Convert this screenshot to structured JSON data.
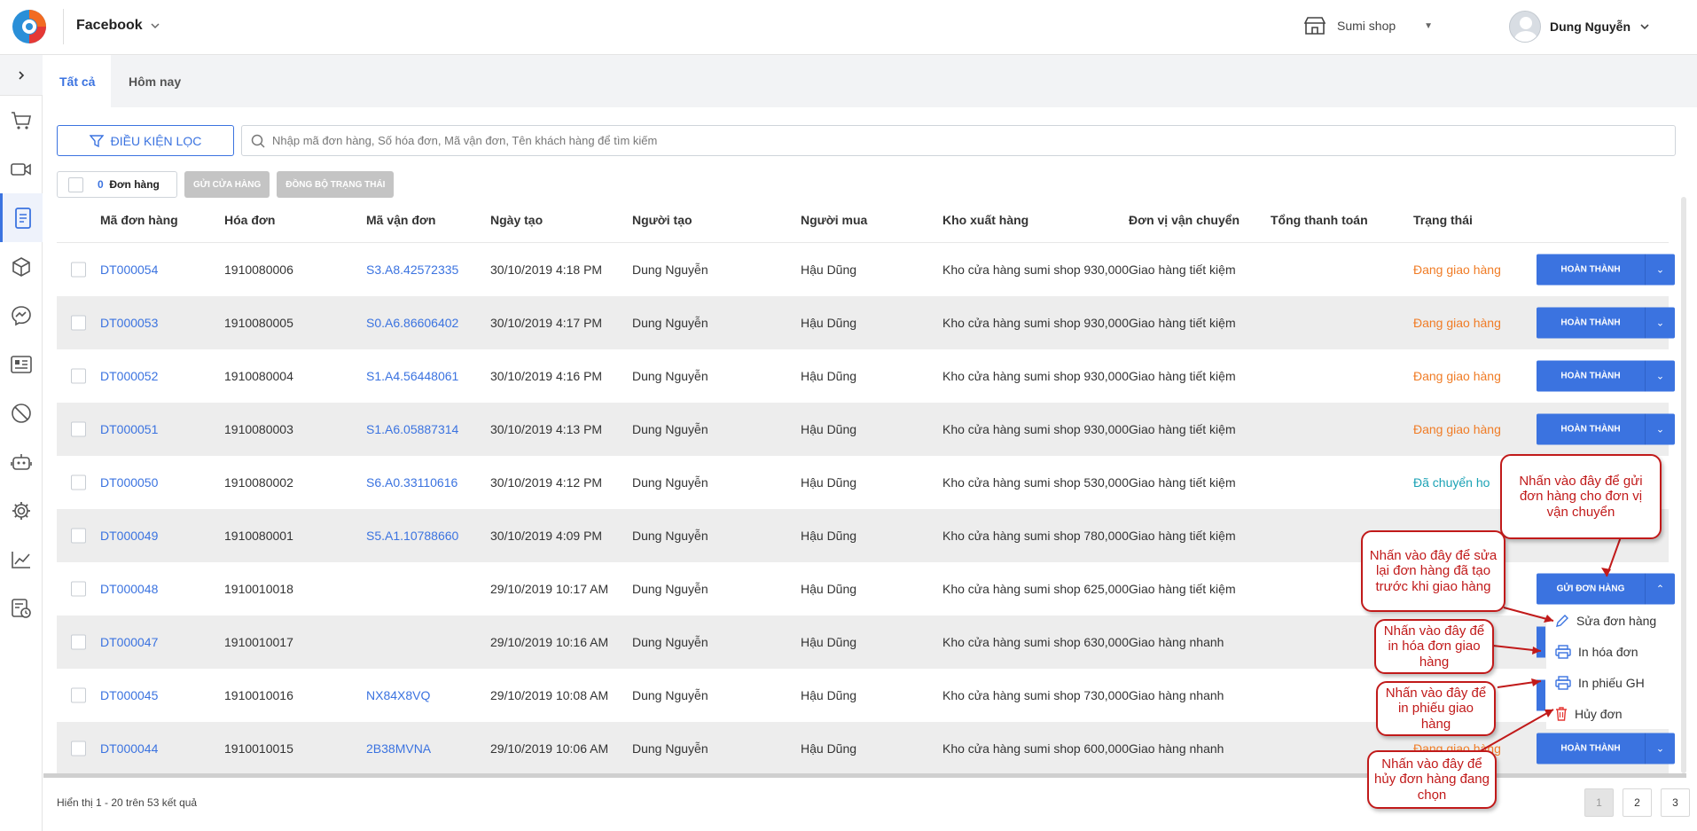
{
  "header": {
    "app_name": "Facebook",
    "shop_name": "Sumi shop",
    "user_name": "Dung Nguyễn"
  },
  "tabs": [
    {
      "label": "Tất cả"
    },
    {
      "label": "Hôm nay"
    }
  ],
  "filter": {
    "button_label": "ĐIỀU KIỆN LỌC",
    "search_placeholder": "Nhập mã đơn hàng, Số hóa đơn, Mã vận đơn, Tên khách hàng để tìm kiếm"
  },
  "bulk": {
    "count": "0",
    "count_label": "Đơn hàng",
    "send_store_label": "GỬI CỬA HÀNG",
    "sync_status_label": "ĐỒNG BỘ TRẠNG THÁI"
  },
  "columns": [
    "Mã đơn hàng",
    "Hóa đơn",
    "Mã vận đơn",
    "Ngày tạo",
    "Người tạo",
    "Người mua",
    "Kho xuất hàng",
    "Đơn vị vận chuyển",
    "Tổng thanh toán",
    "Trạng thái"
  ],
  "rows": [
    {
      "code": "DT000054",
      "invoice": "1910080006",
      "tracking": "S3.A8.42572335",
      "date": "30/10/2019 4:18 PM",
      "creator": "Dung Nguyễn",
      "buyer": "Hậu Dũng",
      "warehouse": "Kho cửa hàng sumi shop",
      "carrier": "Giao hàng tiết kiệm",
      "total": "930,000",
      "status": "Đang giao hàng",
      "action": "HOÀN THÀNH"
    },
    {
      "code": "DT000053",
      "invoice": "1910080005",
      "tracking": "S0.A6.86606402",
      "date": "30/10/2019 4:17 PM",
      "creator": "Dung Nguyễn",
      "buyer": "Hậu Dũng",
      "warehouse": "Kho cửa hàng sumi shop",
      "carrier": "Giao hàng tiết kiệm",
      "total": "930,000",
      "status": "Đang giao hàng",
      "action": "HOÀN THÀNH"
    },
    {
      "code": "DT000052",
      "invoice": "1910080004",
      "tracking": "S1.A4.56448061",
      "date": "30/10/2019 4:16 PM",
      "creator": "Dung Nguyễn",
      "buyer": "Hậu Dũng",
      "warehouse": "Kho cửa hàng sumi shop",
      "carrier": "Giao hàng tiết kiệm",
      "total": "930,000",
      "status": "Đang giao hàng",
      "action": "HOÀN THÀNH"
    },
    {
      "code": "DT000051",
      "invoice": "1910080003",
      "tracking": "S1.A6.05887314",
      "date": "30/10/2019 4:13 PM",
      "creator": "Dung Nguyễn",
      "buyer": "Hậu Dũng",
      "warehouse": "Kho cửa hàng sumi shop",
      "carrier": "Giao hàng tiết kiệm",
      "total": "930,000",
      "status": "Đang giao hàng",
      "action": "HOÀN THÀNH"
    },
    {
      "code": "DT000050",
      "invoice": "1910080002",
      "tracking": "S6.A0.33110616",
      "date": "30/10/2019 4:12 PM",
      "creator": "Dung Nguyễn",
      "buyer": "Hậu Dũng",
      "warehouse": "Kho cửa hàng sumi shop",
      "carrier": "Giao hàng tiết kiệm",
      "total": "530,000",
      "status": "Đã chuyển ho",
      "action": ""
    },
    {
      "code": "DT000049",
      "invoice": "1910080001",
      "tracking": "S5.A1.10788660",
      "date": "30/10/2019 4:09 PM",
      "creator": "Dung Nguyễn",
      "buyer": "Hậu Dũng",
      "warehouse": "Kho cửa hàng sumi shop",
      "carrier": "Giao hàng tiết kiệm",
      "total": "780,000",
      "status": "",
      "action": ""
    },
    {
      "code": "DT000048",
      "invoice": "1910010018",
      "tracking": "",
      "date": "29/10/2019 10:17 AM",
      "creator": "Dung Nguyễn",
      "buyer": "Hậu Dũng",
      "warehouse": "Kho cửa hàng sumi shop",
      "carrier": "Giao hàng tiết kiệm",
      "total": "625,000",
      "status": "",
      "action": "GỬI ĐƠN HÀNG"
    },
    {
      "code": "DT000047",
      "invoice": "1910010017",
      "tracking": "",
      "date": "29/10/2019 10:16 AM",
      "creator": "Dung Nguyễn",
      "buyer": "Hậu Dũng",
      "warehouse": "Kho cửa hàng sumi shop",
      "carrier": "Giao hàng nhanh",
      "total": "630,000",
      "status": "",
      "action": ""
    },
    {
      "code": "DT000045",
      "invoice": "1910010016",
      "tracking": "NX84X8VQ",
      "date": "29/10/2019 10:08 AM",
      "creator": "Dung Nguyễn",
      "buyer": "Hậu Dũng",
      "warehouse": "Kho cửa hàng sumi shop",
      "carrier": "Giao hàng nhanh",
      "total": "730,000",
      "status": "",
      "action": ""
    },
    {
      "code": "DT000044",
      "invoice": "1910010015",
      "tracking": "2B38MVNA",
      "date": "29/10/2019 10:06 AM",
      "creator": "Dung Nguyễn",
      "buyer": "Hậu Dũng",
      "warehouse": "Kho cửa hàng sumi shop",
      "carrier": "Giao hàng nhanh",
      "total": "600,000",
      "status": "Đang giao hàng",
      "action": "HOÀN THÀNH"
    }
  ],
  "menu": {
    "edit": "Sửa đơn hàng",
    "print_invoice": "In hóa đơn",
    "print_delivery": "In phiếu GH",
    "cancel": "Hủy đơn"
  },
  "callouts": {
    "send": "Nhấn vào đây để gửi đơn hàng cho đơn vị vận chuyển",
    "edit": "Nhấn vào đây để sửa lại đơn hàng đã tạo trước khi giao hàng",
    "invoice": "Nhấn vào đây để in hóa đơn giao hàng",
    "delivery": "Nhấn vào đây để in phiếu giao hàng",
    "cancel": "Nhấn vào đây để hủy đơn hàng đang chọn"
  },
  "footer": {
    "summary": "Hiển thị 1 - 20 trên 53 kết quả",
    "pages": [
      "1",
      "2",
      "3"
    ]
  },
  "colors": {
    "accent": "#3b73e0",
    "status_shipping": "#f07c26",
    "status_transferred": "#1ba2b5",
    "callout": "#c11a1a"
  }
}
